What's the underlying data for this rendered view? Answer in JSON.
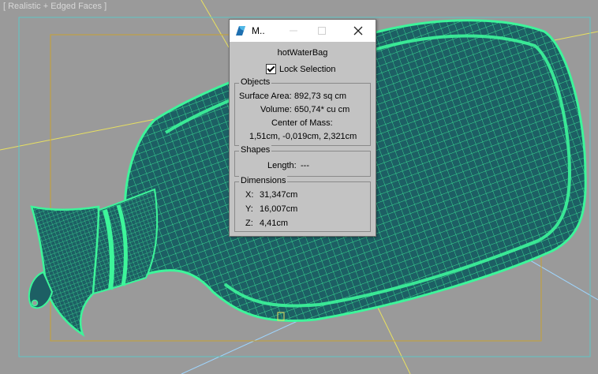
{
  "viewport": {
    "label": "[ Realistic + Edged Faces ]"
  },
  "dialog": {
    "title": "M..",
    "object_name": "hotWaterBag",
    "lock_selection": {
      "label": "Lock Selection",
      "checked": true
    },
    "objects": {
      "title": "Objects",
      "surface_area_label": "Surface Area:",
      "surface_area_value": "892,73 sq cm",
      "volume_label": "Volume:",
      "volume_value": "650,74* cu cm",
      "center_of_mass_label": "Center of Mass:",
      "center_of_mass_value": "1,51cm, -0,019cm, 2,321cm"
    },
    "shapes": {
      "title": "Shapes",
      "length_label": "Length:",
      "length_value": "---"
    },
    "dimensions": {
      "title": "Dimensions",
      "x_label": "X:",
      "x_value": "31,347cm",
      "y_label": "Y:",
      "y_value": "16,007cm",
      "z_label": "Z:",
      "z_value": "4,41cm"
    }
  },
  "colors": {
    "mesh_edge": "#3df59a",
    "mesh_fill": "#1d5f64",
    "safe_frame": "#c8a232",
    "viewport_bg": "#9a9a9a"
  }
}
